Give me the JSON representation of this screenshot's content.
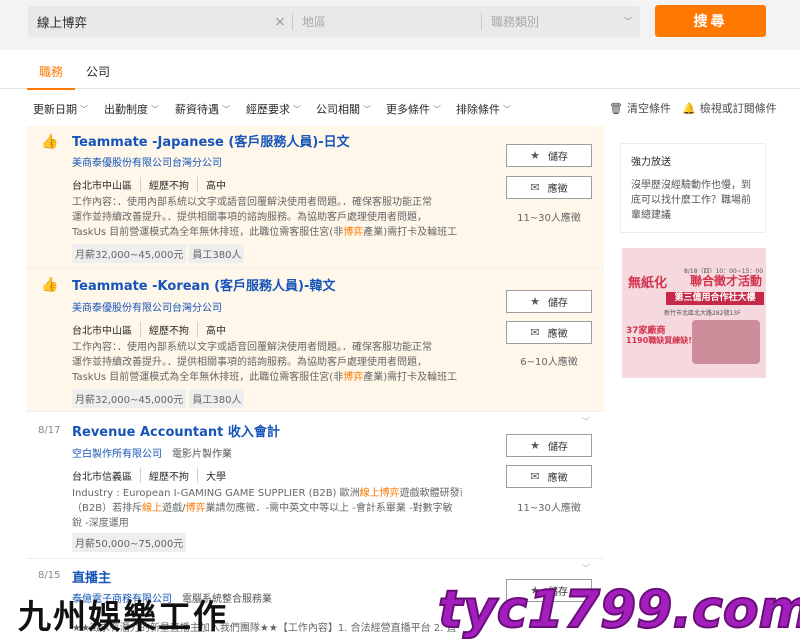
{
  "search": {
    "keyword": "線上博弈",
    "area_placeholder": "地區",
    "job_category_placeholder": "職務類別",
    "button_label": "搜尋"
  },
  "tabs": [
    {
      "label": "職務",
      "active": true
    },
    {
      "label": "公司",
      "active": false
    }
  ],
  "filters": [
    "更新日期",
    "出勤制度",
    "薪資待遇",
    "經歷要求",
    "公司相關",
    "更多條件",
    "排除條件"
  ],
  "filter_actions": {
    "clear": "清空條件",
    "subscribe": "檢視或訂閱條件"
  },
  "jobs": [
    {
      "date": "",
      "title": "Teammate -Japanese (客戶服務人員)-日文",
      "company": "美商泰優股份有限公司台灣分公司",
      "industry": "",
      "location": "台北市中山區",
      "experience": "經歷不拘",
      "education": "高中",
      "desc": [
        "工作內容：．使用內部系統以文字或語音回覆解決使用者問題。．確保客服功能正常",
        "運作並持續改善提升。．提供相關事項的諮詢服務。為協助客戶處理使用者問題，",
        "TaskUs 目前營運模式為全年無休排班，此職位需客服住宮(非博弈產業)需打卡及輪班工"
      ],
      "tags": [
        "月薪32,000~45,000元",
        "員工380人"
      ],
      "save_label": "儲存",
      "apply_label": "應徵",
      "applicants": "11~30人應徵",
      "highlight": true
    },
    {
      "date": "",
      "title": "Teammate -Korean (客戶服務人員)-韓文",
      "company": "美商泰優股份有限公司台灣分公司",
      "industry": "",
      "location": "台北市中山區",
      "experience": "經歷不拘",
      "education": "高中",
      "desc": [
        "工作內容：．使用內部系統以文字或語音回覆解決使用者問題。．確保客服功能正常",
        "運作並持續改善提升。．提供相關事項的諮詢服務。為協助客戶處理使用者問題，",
        "TaskUs 目前營運模式為全年無休排班，此職位需客服住宮(非博弈產業)需打卡及輪班工"
      ],
      "tags": [
        "月薪32,000~45,000元",
        "員工380人"
      ],
      "save_label": "儲存",
      "apply_label": "應徵",
      "applicants": "6~10人應徵",
      "highlight": true
    },
    {
      "date": "8/17",
      "title": "Revenue Accountant 收入會計",
      "company": "空白製作所有限公司",
      "industry": "電影片製作業",
      "location": "台北市信義區",
      "experience": "經歷不拘",
      "education": "大學",
      "desc": [
        "Industry : European I-GAMING GAME SUPPLIER (B2B) 歐洲線上博弈遊戲軟體研發商",
        "（B2B）若排斥線上遊戲/博弈業請勿應徵．-需中英文中等以上 -會計系畢業 -對數字敏",
        "銳 -深度運用"
      ],
      "tags": [
        "月薪50,000~75,000元"
      ],
      "save_label": "儲存",
      "apply_label": "應徵",
      "applicants": "11~30人應徵",
      "highlight": false
    },
    {
      "date": "8/15",
      "title": "直播主",
      "company": "泰億電子商務有限公司",
      "industry": "電腦系統整合服務業",
      "location": "",
      "experience": "",
      "education": "",
      "desc": [
        "",
        "",
        "★★徵求有潛力的新星直播主加入我們團隊★★【工作內容】1. 合法經營直播平台 2. 直"
      ],
      "tags": [],
      "save_label": "儲存",
      "apply_label": "應徵",
      "applicants": "",
      "highlight": false
    }
  ],
  "side_promo": {
    "title": "強力放送",
    "text": "沒學歷沒經驗動作也慢，到底可以找什麼工作？職場前輩總建議"
  },
  "ad": {
    "line1": "無紙化",
    "line2": "聯合徵才活動",
    "banner": "第三億用合作社大樓",
    "address": "新竹市北區北大路282號13F",
    "line3": "37家廠商",
    "line4": "1190職缺質練缺!",
    "small": "8/18（四）10：00~15：00"
  },
  "watermark": {
    "left": "九州娛樂工作",
    "right": "tyc1799.com"
  },
  "colors": {
    "accent": "#ff7800",
    "link": "#1654b9",
    "highlight_bg": "#fff8ea",
    "watermark_purple": "#a31fbd"
  }
}
